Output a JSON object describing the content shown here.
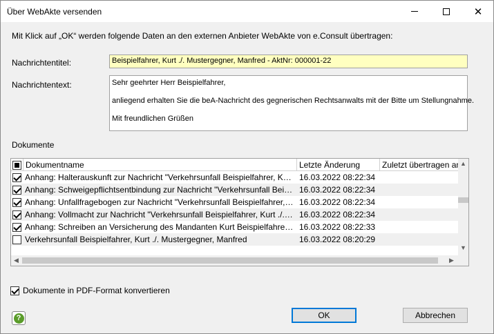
{
  "window": {
    "title": "Über WebAkte versenden",
    "minimize_icon": "minimize-icon",
    "maximize_icon": "maximize-icon",
    "close_symbol": "✕"
  },
  "info_text": "Mit Klick auf „OK“ werden folgende Daten an den externen Anbieter WebAkte von e.Consult übertragen:",
  "form": {
    "titel_label": "Nachrichtentitel:",
    "titel_value": "Beispielfahrer, Kurt ./. Mustergegner, Manfred - AktNr: 000001-22",
    "text_label": "Nachrichtentext:",
    "text_lines": [
      "Sehr geehrter Herr Beispielfahrer,",
      "anliegend erhalten Sie die beA-Nachricht des gegnerischen Rechtsanwalts mit der Bitte um Stellungnahme.",
      "Mit freundlichen Grüßen"
    ]
  },
  "documents": {
    "section_label": "Dokumente",
    "columns": [
      "Dokumentname",
      "Letzte Änderung",
      "Zuletzt übertragen am"
    ],
    "rows": [
      {
        "checked": true,
        "name": "Anhang: Halterauskunft zur Nachricht \"Verkehrsunfall Beispielfahrer, Kurt ./...",
        "date": "16.03.2022 08:22:34",
        "sent": ""
      },
      {
        "checked": true,
        "name": "Anhang: Schweigepflichtsentbindung zur Nachricht \"Verkehrsunfall Beispielf...",
        "date": "16.03.2022 08:22:34",
        "sent": ""
      },
      {
        "checked": true,
        "name": "Anhang: Unfallfragebogen zur Nachricht \"Verkehrsunfall Beispielfahrer, Kurt...",
        "date": "16.03.2022 08:22:34",
        "sent": ""
      },
      {
        "checked": true,
        "name": "Anhang: Vollmacht zur Nachricht \"Verkehrsunfall Beispielfahrer, Kurt ./. Must...",
        "date": "16.03.2022 08:22:34",
        "sent": ""
      },
      {
        "checked": true,
        "name": "Anhang: Schreiben an Versicherung des Mandanten Kurt Beispielfahrer zur...",
        "date": "16.03.2022 08:22:33",
        "sent": ""
      },
      {
        "checked": false,
        "name": "Verkehrsunfall Beispielfahrer, Kurt ./. Mustergegner, Manfred",
        "date": "16.03.2022 08:20:29",
        "sent": ""
      }
    ]
  },
  "pdf_option": {
    "checked": true,
    "label": "Dokumente in PDF-Format konvertieren"
  },
  "buttons": {
    "help_glyph": "?",
    "ok": "OK",
    "cancel": "Abbrechen"
  },
  "scroll_arrows": {
    "up": "▲",
    "down": "▼",
    "left": "◀",
    "right": "▶"
  }
}
